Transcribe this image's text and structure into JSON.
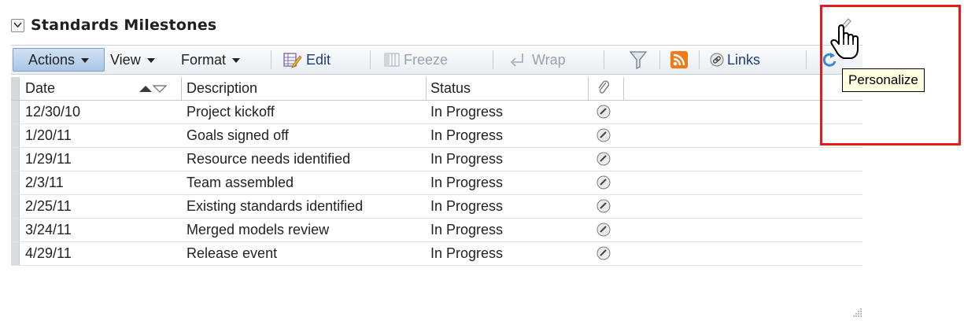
{
  "panel": {
    "title": "Standards Milestones"
  },
  "toolbar": {
    "actions_label": "Actions",
    "view_label": "View",
    "format_label": "Format",
    "edit_label": "Edit",
    "freeze_label": "Freeze",
    "wrap_label": "Wrap",
    "links_label": "Links"
  },
  "table": {
    "columns": {
      "date": "Date",
      "description": "Description",
      "status": "Status"
    },
    "rows": [
      {
        "date": "12/30/10",
        "description": "Project kickoff",
        "status": "In Progress"
      },
      {
        "date": "1/20/11",
        "description": "Goals signed off",
        "status": "In Progress"
      },
      {
        "date": "1/29/11",
        "description": "Resource needs identified",
        "status": "In Progress"
      },
      {
        "date": "2/3/11",
        "description": "Team assembled",
        "status": "In Progress"
      },
      {
        "date": "2/25/11",
        "description": "Existing standards identified",
        "status": "In Progress"
      },
      {
        "date": "3/24/11",
        "description": "Merged models review",
        "status": "In Progress"
      },
      {
        "date": "4/29/11",
        "description": "Release event",
        "status": "In Progress"
      }
    ]
  },
  "tooltip": {
    "text": "Personalize"
  },
  "colors": {
    "highlight": "#e01d1d",
    "tooltip_bg": "#ffffe1",
    "rss": "#f07a17",
    "toolbar_accent": "#a9c5e6"
  },
  "icons": [
    "collapse-icon",
    "edit-icon",
    "freeze-icon",
    "wrap-icon",
    "filter-icon",
    "rss-icon",
    "link-icon",
    "refresh-icon",
    "pencil-icon",
    "hand-cursor-icon",
    "resize-grip-icon"
  ]
}
